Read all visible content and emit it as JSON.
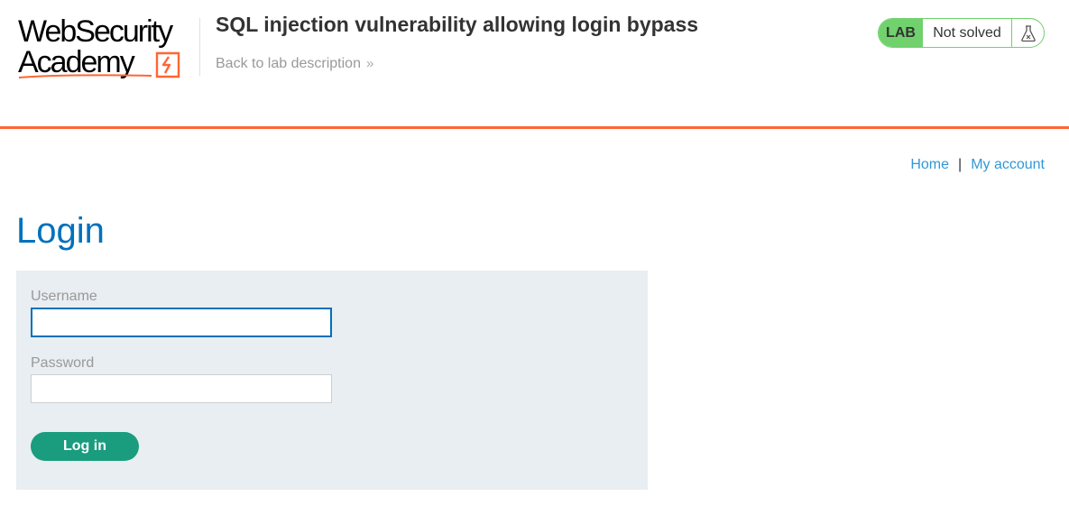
{
  "header": {
    "logo": {
      "line1": "WebSecurity",
      "line2": "Academy"
    },
    "lab_title": "SQL injection vulnerability allowing login bypass",
    "back_link_label": "Back to lab description",
    "back_link_chevron": "»"
  },
  "lab_status": {
    "badge": "LAB",
    "status": "Not solved",
    "icon": "flask-icon",
    "color": "#70d16d"
  },
  "nav": {
    "home": "Home",
    "separator": "|",
    "my_account": "My account"
  },
  "login": {
    "title": "Login",
    "username_label": "Username",
    "username_value": "",
    "password_label": "Password",
    "password_value": "",
    "submit_label": "Log in"
  },
  "colors": {
    "accent_orange": "#ff6633",
    "title_blue": "#0071bc",
    "link_blue": "#3198d7",
    "button_green": "#1a9c7e",
    "panel_bg": "#e8eef1"
  }
}
